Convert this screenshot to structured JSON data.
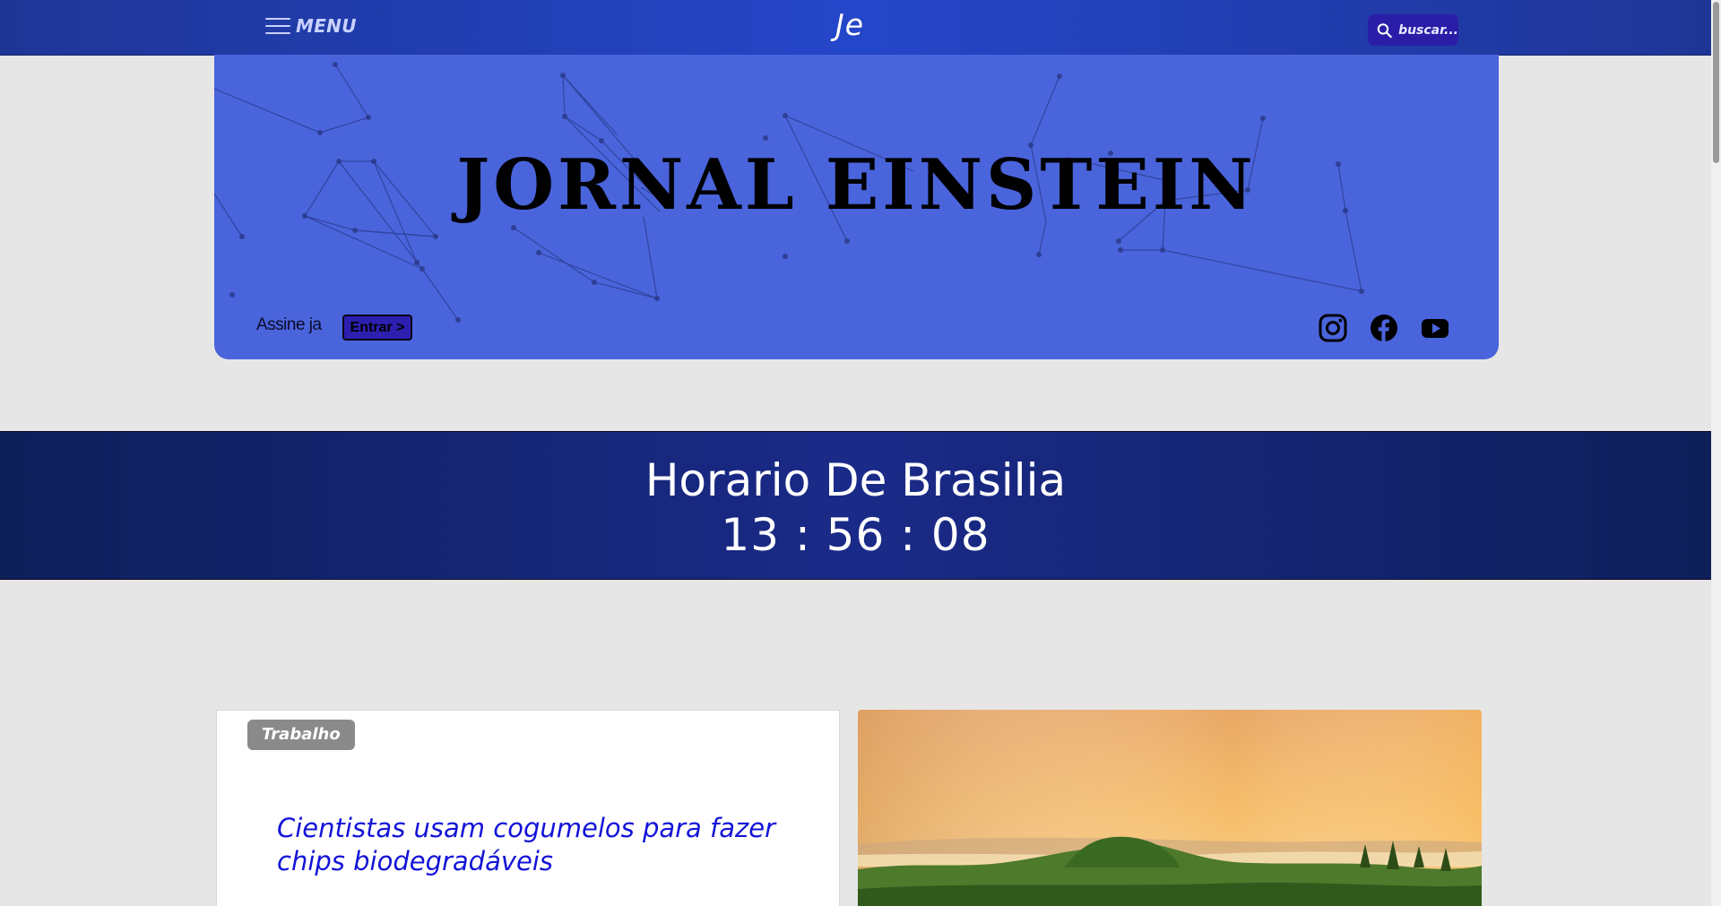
{
  "header": {
    "menu_label": "MENU",
    "logo": "Je",
    "search_placeholder": "buscar..."
  },
  "hero": {
    "title": "JORNAL EINSTEIN",
    "subscribe_text": "Assine ja",
    "enter_label": "Entrar >",
    "social_icons": [
      "instagram-icon",
      "facebook-icon",
      "youtube-icon"
    ]
  },
  "clock": {
    "title": "Horario De Brasilia",
    "time": "13 : 56 : 08"
  },
  "articles": [
    {
      "tag": "Trabalho",
      "headline": "Cientistas usam cogumelos para fazer chips biodegradáveis"
    }
  ],
  "colors": {
    "nav_bg": "#2446c9",
    "hero_bg": "#4a64dc",
    "clock_bg": "#1a2a88",
    "headline": "#1414d8",
    "tag_bg": "#8a8a8a",
    "page_bg": "#e6e6e6"
  }
}
